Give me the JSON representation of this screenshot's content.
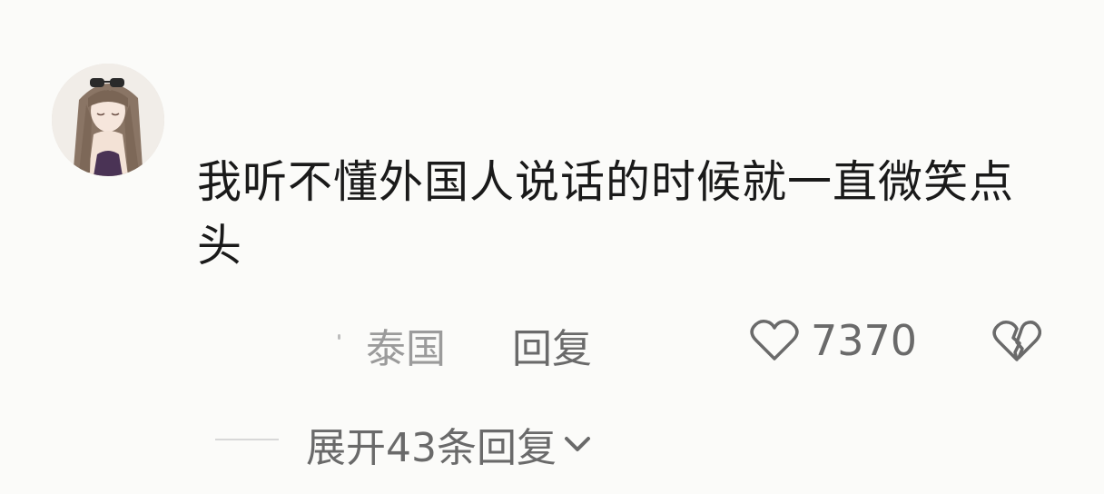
{
  "comment": {
    "avatar_icon": "user-avatar-anime-girl",
    "text": "我听不懂外国人说话的时候就一直微笑点头",
    "location": "泰国",
    "reply_label": "回复",
    "like_icon": "heart-outline-icon",
    "like_count": "7370",
    "dislike_icon": "broken-heart-icon"
  },
  "replies": {
    "expand_label": "展开43条回复",
    "expand_icon": "chevron-down-icon"
  },
  "colors": {
    "background": "#fbfbf9",
    "text_primary": "#1a1a1a",
    "text_secondary": "#6a6a6a",
    "text_muted": "#9b9b9b"
  }
}
